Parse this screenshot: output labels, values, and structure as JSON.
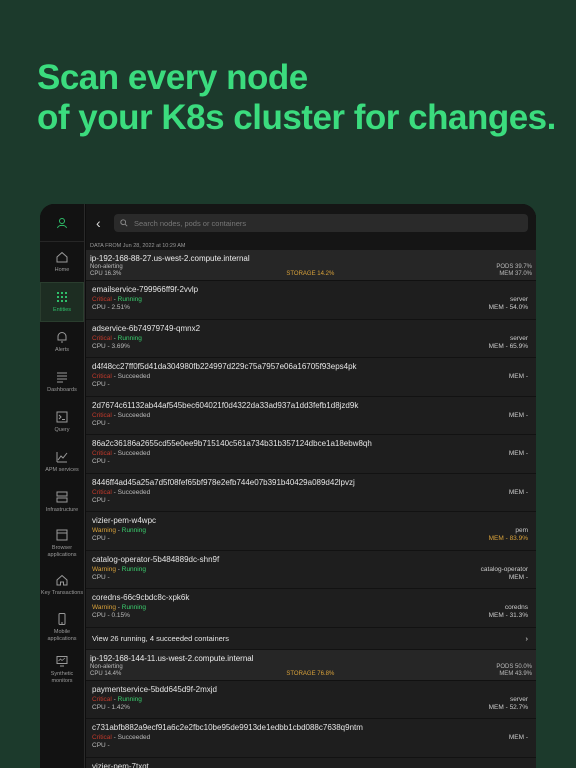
{
  "headline": {
    "line1": "Scan every node",
    "line2": "of your K8s cluster for changes."
  },
  "search": {
    "placeholder": "Search nodes, pods or containers"
  },
  "data_from": "DATA FROM Jun 28, 2022 at 10:29 AM",
  "sidebar": [
    {
      "label": "Home",
      "icon": "home-icon"
    },
    {
      "label": "Entities",
      "icon": "grid-icon"
    },
    {
      "label": "Alerts",
      "icon": "bell-icon"
    },
    {
      "label": "Dashboards",
      "icon": "dashboard-icon"
    },
    {
      "label": "Query",
      "icon": "terminal-icon"
    },
    {
      "label": "APM services",
      "icon": "chart-icon"
    },
    {
      "label": "Infrastructure",
      "icon": "server-icon"
    },
    {
      "label": "Browser applications",
      "icon": "browser-icon"
    },
    {
      "label": "Key Transactions",
      "icon": "house-icon"
    },
    {
      "label": "Mobile applications",
      "icon": "mobile-icon"
    },
    {
      "label": "Synthetic monitors",
      "icon": "monitor-icon"
    }
  ],
  "node1": {
    "name": "ip-192-168-88-27.us-west-2.compute.internal",
    "status": "Non-alerting",
    "cpu": "CPU 16.3%",
    "storage": "STORAGE 14.2%",
    "pods": "PODS 39.7%",
    "mem": "MEM 37.0%"
  },
  "items": [
    {
      "name": "emailservice-799966ff9f-2vvlp",
      "state": "Critical",
      "phase": "Running",
      "cpu": "CPU - 2.51%",
      "right1": "server",
      "right2": "MEM - 54.0%"
    },
    {
      "name": "adservice-6b74979749-qmnx2",
      "state": "Critical",
      "phase": "Running",
      "cpu": "CPU - 3.69%",
      "right1": "server",
      "right2": "MEM - 65.9%"
    },
    {
      "name": "d4f48cc27ff0f5d41da304980fb224997d229c75a7957e06a16705f93eps4pk",
      "state": "Critical",
      "phase": "Succeeded",
      "cpu": "CPU -",
      "right1": "",
      "right2": "MEM -"
    },
    {
      "name": "2d7674c61132ab44af545bec604021f0d4322da33ad937a1dd3fefb1d8jzd9k",
      "state": "Critical",
      "phase": "Succeeded",
      "cpu": "CPU -",
      "right1": "",
      "right2": "MEM -"
    },
    {
      "name": "86a2c36186a2655cd55e0ee9b715140c561a734b31b357124dbce1a18ebw8qh",
      "state": "Critical",
      "phase": "Succeeded",
      "cpu": "CPU -",
      "right1": "",
      "right2": "MEM -"
    },
    {
      "name": "8446ff4ad45a25a7d5f08fef65bf978e2efb744e07b391b40429a089d42lpvzj",
      "state": "Critical",
      "phase": "Succeeded",
      "cpu": "CPU -",
      "right1": "",
      "right2": "MEM -"
    },
    {
      "name": "vizier-pem-w4wpc",
      "state": "Warning",
      "phase": "Running",
      "cpu": "CPU -",
      "right1": "pem",
      "right2": "MEM - 83.9%"
    },
    {
      "name": "catalog-operator-5b484889dc-shn9f",
      "state": "Warning",
      "phase": "Running",
      "cpu": "CPU -",
      "right1": "catalog-operator",
      "right2": "MEM -"
    },
    {
      "name": "coredns-66c9cbdc8c-xpk6k",
      "state": "Warning",
      "phase": "Running",
      "cpu": "CPU - 0.15%",
      "right1": "coredns",
      "right2": "MEM - 31.3%"
    }
  ],
  "view_all": "View 26 running, 4 succeeded containers",
  "node2": {
    "name": "ip-192-168-144-11.us-west-2.compute.internal",
    "status": "Non-alerting",
    "cpu": "CPU 14.4%",
    "storage": "STORAGE 76.8%",
    "pods": "PODS 50.0%",
    "mem": "MEM 43.9%"
  },
  "items2": [
    {
      "name": "paymentservice-5bdd645d9f-2mxjd",
      "state": "Critical",
      "phase": "Running",
      "cpu": "CPU - 1.42%",
      "right1": "server",
      "right2": "MEM - 52.7%"
    },
    {
      "name": "c731abfb882a9ecf91a6c2e2fbc10be95de9913de1edbb1cbd088c7638q9ntm",
      "state": "Critical",
      "phase": "Succeeded",
      "cpu": "CPU -",
      "right1": "",
      "right2": "MEM -"
    },
    {
      "name": "vizier-pem-7txqt",
      "state": "",
      "phase": "",
      "cpu": "",
      "right1": "",
      "right2": ""
    }
  ]
}
